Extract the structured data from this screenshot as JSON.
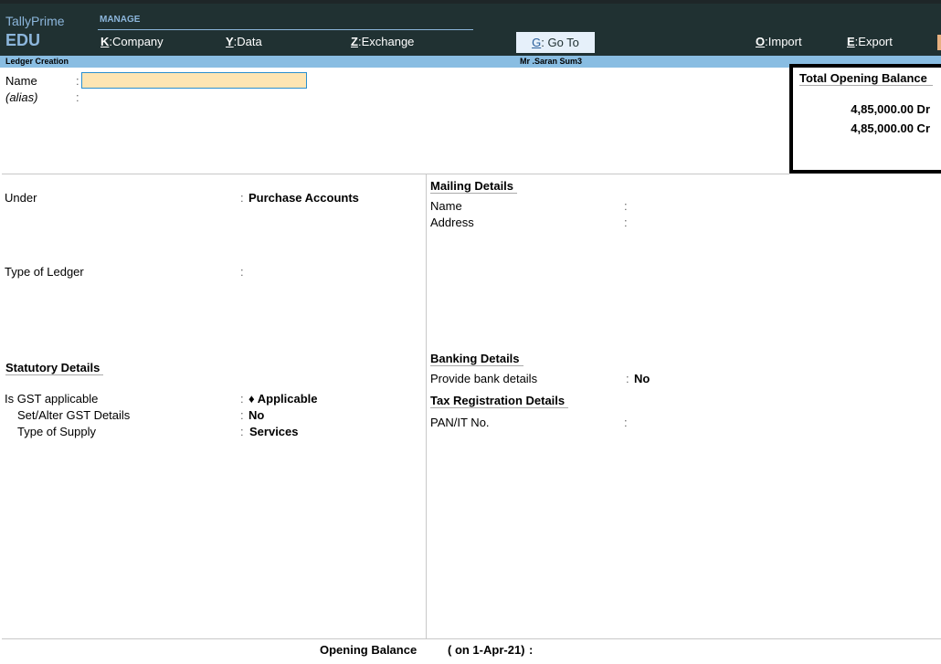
{
  "app": {
    "product": "TallyPrime",
    "edition": "EDU"
  },
  "topmenu": {
    "group_label": "MANAGE",
    "items": [
      {
        "key": "K",
        "label": "Company"
      },
      {
        "key": "Y",
        "label": "Data"
      },
      {
        "key": "Z",
        "label": "Exchange"
      },
      {
        "key": "G",
        "label": "Go To"
      },
      {
        "key": "O",
        "label": "Import"
      },
      {
        "key": "E",
        "label": "Export"
      }
    ]
  },
  "titlebar": {
    "screen": "Ledger Creation",
    "company": "Mr .Saran Sum3"
  },
  "form": {
    "name_label": "Name",
    "name_value": "",
    "alias_label": "(alias)",
    "under_label": "Under",
    "under_value": "Purchase Accounts",
    "type_of_ledger_label": "Type of Ledger",
    "type_of_ledger_value": "",
    "statutory": {
      "heading": "Statutory Details",
      "gst_applicable_label": "Is GST applicable",
      "gst_applicable_value": "♦ Applicable",
      "set_alter_gst_label": "Set/Alter GST Details",
      "set_alter_gst_value": "No",
      "type_of_supply_label": "Type of Supply",
      "type_of_supply_value": "Services"
    },
    "mailing": {
      "heading": "Mailing Details",
      "name_label": "Name",
      "address_label": "Address"
    },
    "banking": {
      "heading": "Banking Details",
      "provide_label": "Provide bank details",
      "provide_value": "No"
    },
    "tax": {
      "heading": "Tax Registration Details",
      "pan_label": "PAN/IT No."
    },
    "opening_balance": {
      "label": "Opening Balance",
      "date": "( on 1-Apr-21)",
      "colon": ":"
    }
  },
  "total_opening_balance": {
    "title": "Total Opening Balance",
    "debit": "4,85,000.00 Dr",
    "credit": "4,85,000.00 Cr"
  },
  "separator": ":"
}
